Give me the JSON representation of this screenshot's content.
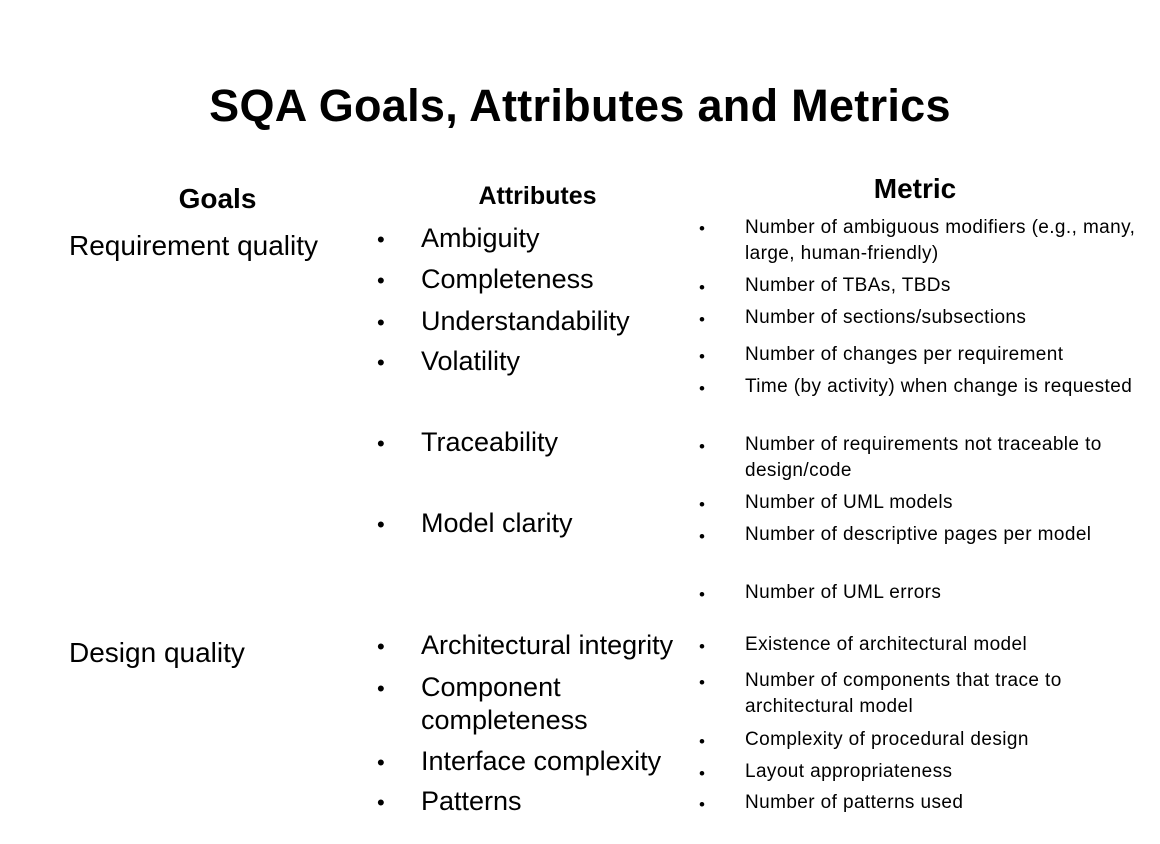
{
  "title": "SQA Goals, Attributes and Metrics",
  "headers": {
    "goals": "Goals",
    "attributes": "Attributes",
    "metric": "Metric"
  },
  "goals": [
    "Requirement quality",
    "Design quality"
  ],
  "attributes": [
    "Ambiguity",
    "Completeness",
    "Understandability",
    "Volatility",
    "Traceability",
    "Model clarity",
    "Architectural integrity",
    "Component completeness",
    "Interface complexity",
    "Patterns"
  ],
  "metrics": [
    "Number of ambiguous modifiers (e.g., many, large, human-friendly)",
    "Number of TBAs, TBDs",
    "Number of sections/subsections",
    "Number of changes per requirement",
    "Time (by activity) when change is requested",
    "Number of requirements not traceable to design/code",
    "Number of UML models",
    "Number of descriptive pages per model",
    "Number of UML errors",
    "Existence of architectural model",
    "Number of components that trace to architectural model",
    "Complexity of procedural design",
    "Layout appropriateness",
    "Number of patterns used"
  ],
  "bullet_char": "•"
}
